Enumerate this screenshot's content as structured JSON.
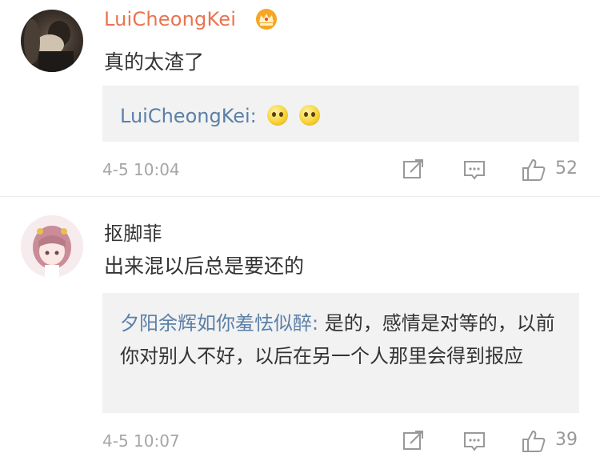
{
  "comments": [
    {
      "username": "LuiCheongKei",
      "text": "真的太渣了",
      "reply": {
        "user": "LuiCheongKei:",
        "text": ""
      },
      "time": "4-5 10:04",
      "likes": "52",
      "badge_icon": "crown-icon",
      "name_color": "#eb7350"
    },
    {
      "username": "抠脚菲",
      "text": "出来混以后总是要还的",
      "reply": {
        "user": "夕阳余辉如你羞怯似醉:",
        "text": " 是的，感情是对等的，以前你对别人不好，以后在另一个人那里会得到报应"
      },
      "time": "4-5 10:07",
      "likes": "39"
    }
  ],
  "colors": {
    "link": "#5b80a8",
    "meta": "#a6a6a6",
    "reply_bg": "#f2f2f2"
  }
}
